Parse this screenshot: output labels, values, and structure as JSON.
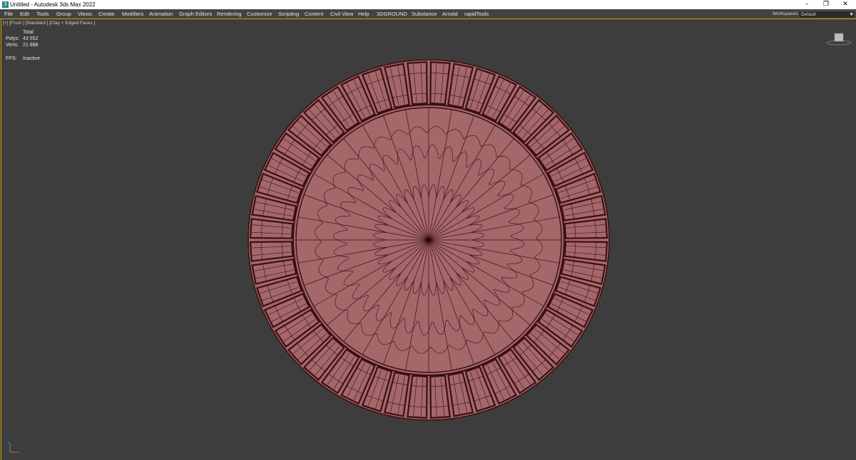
{
  "titlebar": {
    "title": "Untitled - Autodesk 3ds Max 2022",
    "minimize": "–",
    "restore": "❐",
    "close": "✕"
  },
  "menu": [
    "File",
    "Edit",
    "Tools",
    "Group",
    "Views",
    "Create",
    "Modifiers",
    "Animation",
    "Graph Editors",
    "Rendering",
    "Customize",
    "Scripting",
    "Content",
    "Civil View",
    "Help",
    "3DGROUND",
    "Substance",
    "Arnold",
    "rapidTools"
  ],
  "workspaces": {
    "label": "Workspaces:",
    "value": "Default"
  },
  "viewport": {
    "label": "[+] [Front ] [Standard ] [Clay + Edged Faces ]",
    "stats": {
      "header": "Total",
      "polys_label": "Polys:",
      "polys_value": "43 552",
      "verts_label": "Verts:",
      "verts_value": "21 888",
      "fps_label": "FPS:",
      "fps_value": "Inactive"
    }
  },
  "colors": {
    "viewport_bg": "#3d3d3d",
    "clay_face": "#a4676a",
    "wire": "#3a1012",
    "highlight": "#c8a600"
  }
}
